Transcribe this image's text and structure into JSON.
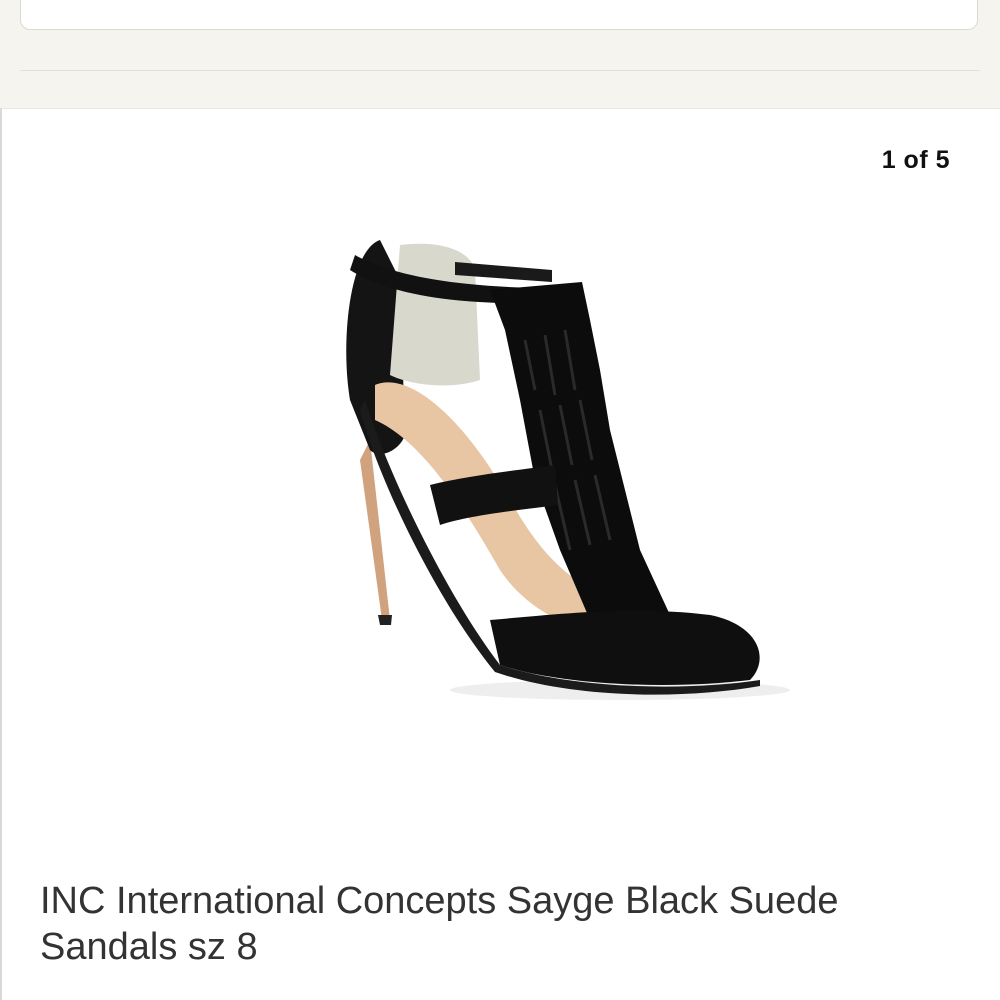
{
  "search": {
    "value": "",
    "placeholder": ""
  },
  "gallery": {
    "counter": "1 of 5",
    "image_subject": "black suede fringe strappy high-heel sandal"
  },
  "product": {
    "title": "INC International Concepts Sayge Black Suede Sandals sz 8"
  },
  "colors": {
    "header_bg": "#f6f4ef",
    "text": "#333333",
    "counter": "#111111"
  }
}
